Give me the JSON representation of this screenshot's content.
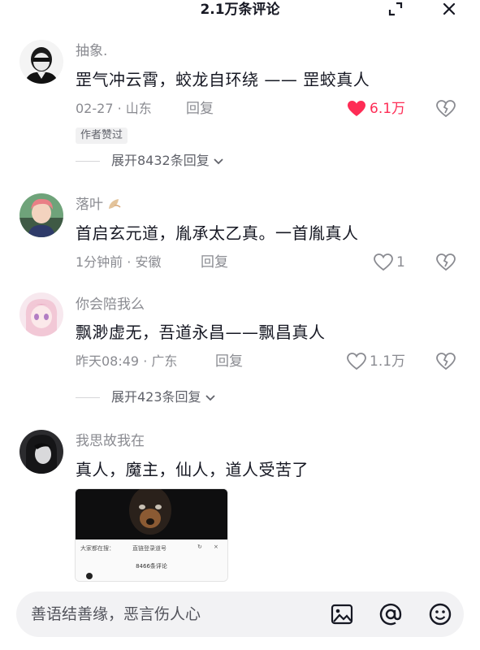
{
  "header": {
    "title": "2.1万条评论",
    "expand_icon": "expand-corner-icon",
    "close_icon": "close-icon"
  },
  "comments": [
    {
      "user": "抽象.",
      "text": "罡气冲云霄，蛟龙自环绕 —— 罡蛟真人",
      "meta": "02-27 · 山东",
      "reply_label": "回复",
      "likes": "6.1万",
      "liked": true,
      "badge": "作者赞过",
      "expand": "展开8432条回复"
    },
    {
      "user": "落叶",
      "text": "首启玄元道，胤承太乙真。一首胤真人",
      "meta": "1分钟前 · 安徽",
      "reply_label": "回复",
      "likes": "1",
      "liked": false
    },
    {
      "user": "你会陪我么",
      "text": "飘渺虚无，吾道永昌——飘昌真人",
      "meta": "昨天08:49 · 广东",
      "reply_label": "回复",
      "likes": "1.1万",
      "liked": false,
      "expand": "展开423条回复"
    },
    {
      "user": "我思故我在",
      "text": "真人，魔主，仙人，道人受苦了",
      "attachment": {
        "tab_1": "大家都在搜：",
        "tab_2": "直链登录道号",
        "count": "8466条评论"
      }
    }
  ],
  "input_bar": {
    "placeholder": "善语结善缘，恶言伤人心",
    "icons": [
      "image-icon",
      "at-icon",
      "emoji-icon"
    ]
  },
  "colors": {
    "like_red": "#fe2c55",
    "secondary_text": "#8a8b91",
    "primary_text": "#161823"
  }
}
